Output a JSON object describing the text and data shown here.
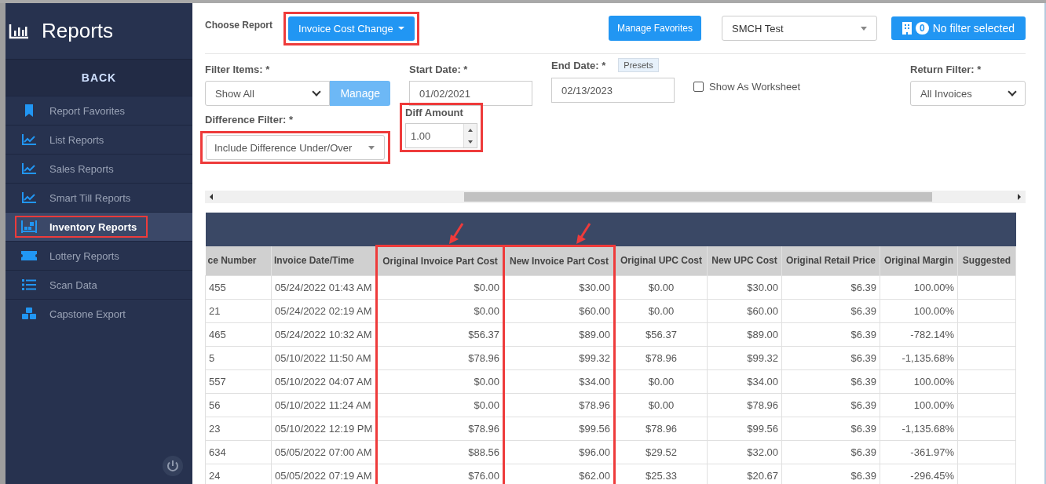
{
  "sidebar": {
    "title": "Reports",
    "back_label": "BACK",
    "items": [
      {
        "label": "Report Favorites",
        "kind": "bookmark",
        "selected": false,
        "annotated": false
      },
      {
        "label": "List Reports",
        "kind": "chart",
        "selected": false,
        "annotated": false
      },
      {
        "label": "Sales Reports",
        "kind": "chart",
        "selected": false,
        "annotated": false
      },
      {
        "label": "Smart Till Reports",
        "kind": "chart",
        "selected": false,
        "annotated": false
      },
      {
        "label": "Inventory Reports",
        "kind": "inventory",
        "selected": true,
        "annotated": true
      },
      {
        "label": "Lottery Reports",
        "kind": "ticket",
        "selected": false,
        "annotated": false
      },
      {
        "label": "Scan Data",
        "kind": "list",
        "selected": false,
        "annotated": false
      },
      {
        "label": "Capstone Export",
        "kind": "cubes",
        "selected": false,
        "annotated": false
      }
    ]
  },
  "top_bar": {
    "choose_report_label": "Choose Report",
    "report_button": {
      "label": "Invoice Cost Change",
      "annotated": true
    },
    "manage_favorites": "Manage Favorites",
    "store_select": "SMCH Test",
    "filter_button": {
      "count": "0",
      "label": "No filter selected"
    }
  },
  "filters": {
    "filter_items": {
      "label": "Filter Items: *",
      "value": "Show All",
      "manage_label": "Manage"
    },
    "start_date": {
      "label": "Start Date: *",
      "value": "01/02/2021"
    },
    "end_date": {
      "label": "End Date: *",
      "value": "02/13/2023",
      "presets": "Presets"
    },
    "worksheet": {
      "label": "Show As Worksheet",
      "checked": false
    },
    "return_filter": {
      "label": "Return Filter: *",
      "value": "All Invoices"
    },
    "difference_filter": {
      "label": "Difference Filter: *",
      "value": "Include Difference Under/Over",
      "annotated": true
    },
    "diff_amount": {
      "label": "Diff Amount",
      "value": "1.00",
      "annotated": true
    }
  },
  "table": {
    "columns": [
      {
        "label": "ce Number",
        "annotated": false
      },
      {
        "label": "Invoice Date/Time",
        "annotated": false
      },
      {
        "label": "Original Invoice Part Cost",
        "annotated": true
      },
      {
        "label": "New Invoice Part Cost",
        "annotated": true
      },
      {
        "label": "Original UPC Cost",
        "annotated": false
      },
      {
        "label": "New UPC Cost",
        "annotated": false
      },
      {
        "label": "Original Retail Price",
        "annotated": false
      },
      {
        "label": "Original Margin",
        "annotated": false
      },
      {
        "label": "Suggested",
        "annotated": false
      }
    ],
    "rows": [
      [
        "455",
        "05/24/2022 01:43 AM",
        "$0.00",
        "$30.00",
        "$0.00",
        "$30.00",
        "$6.39",
        "100.00%",
        ""
      ],
      [
        "21",
        "05/24/2022 02:19 AM",
        "$0.00",
        "$60.00",
        "$0.00",
        "$60.00",
        "$6.39",
        "100.00%",
        ""
      ],
      [
        "465",
        "05/24/2022 10:32 AM",
        "$56.37",
        "$89.00",
        "$56.37",
        "$89.00",
        "$6.39",
        "-782.14%",
        ""
      ],
      [
        "5",
        "05/10/2022 11:50 AM",
        "$78.96",
        "$99.32",
        "$78.96",
        "$99.32",
        "$6.39",
        "-1,135.68%",
        ""
      ],
      [
        "557",
        "05/10/2022 04:07 AM",
        "$0.00",
        "$34.00",
        "$0.00",
        "$34.00",
        "$6.39",
        "100.00%",
        ""
      ],
      [
        "56",
        "05/10/2022 11:24 AM",
        "$0.00",
        "$78.96",
        "$0.00",
        "$78.96",
        "$6.39",
        "100.00%",
        ""
      ],
      [
        "23",
        "05/10/2022 12:19 PM",
        "$78.96",
        "$99.56",
        "$78.96",
        "$99.56",
        "$6.39",
        "-1,135.68%",
        ""
      ],
      [
        "634",
        "05/05/2022 07:00 AM",
        "$88.56",
        "$96.00",
        "$29.52",
        "$32.00",
        "$6.39",
        "-361.97%",
        ""
      ],
      [
        "24",
        "05/05/2022 07:19 AM",
        "$76.00",
        "$62.00",
        "$25.33",
        "$20.67",
        "$6.39",
        "-296.45%",
        ""
      ]
    ]
  }
}
